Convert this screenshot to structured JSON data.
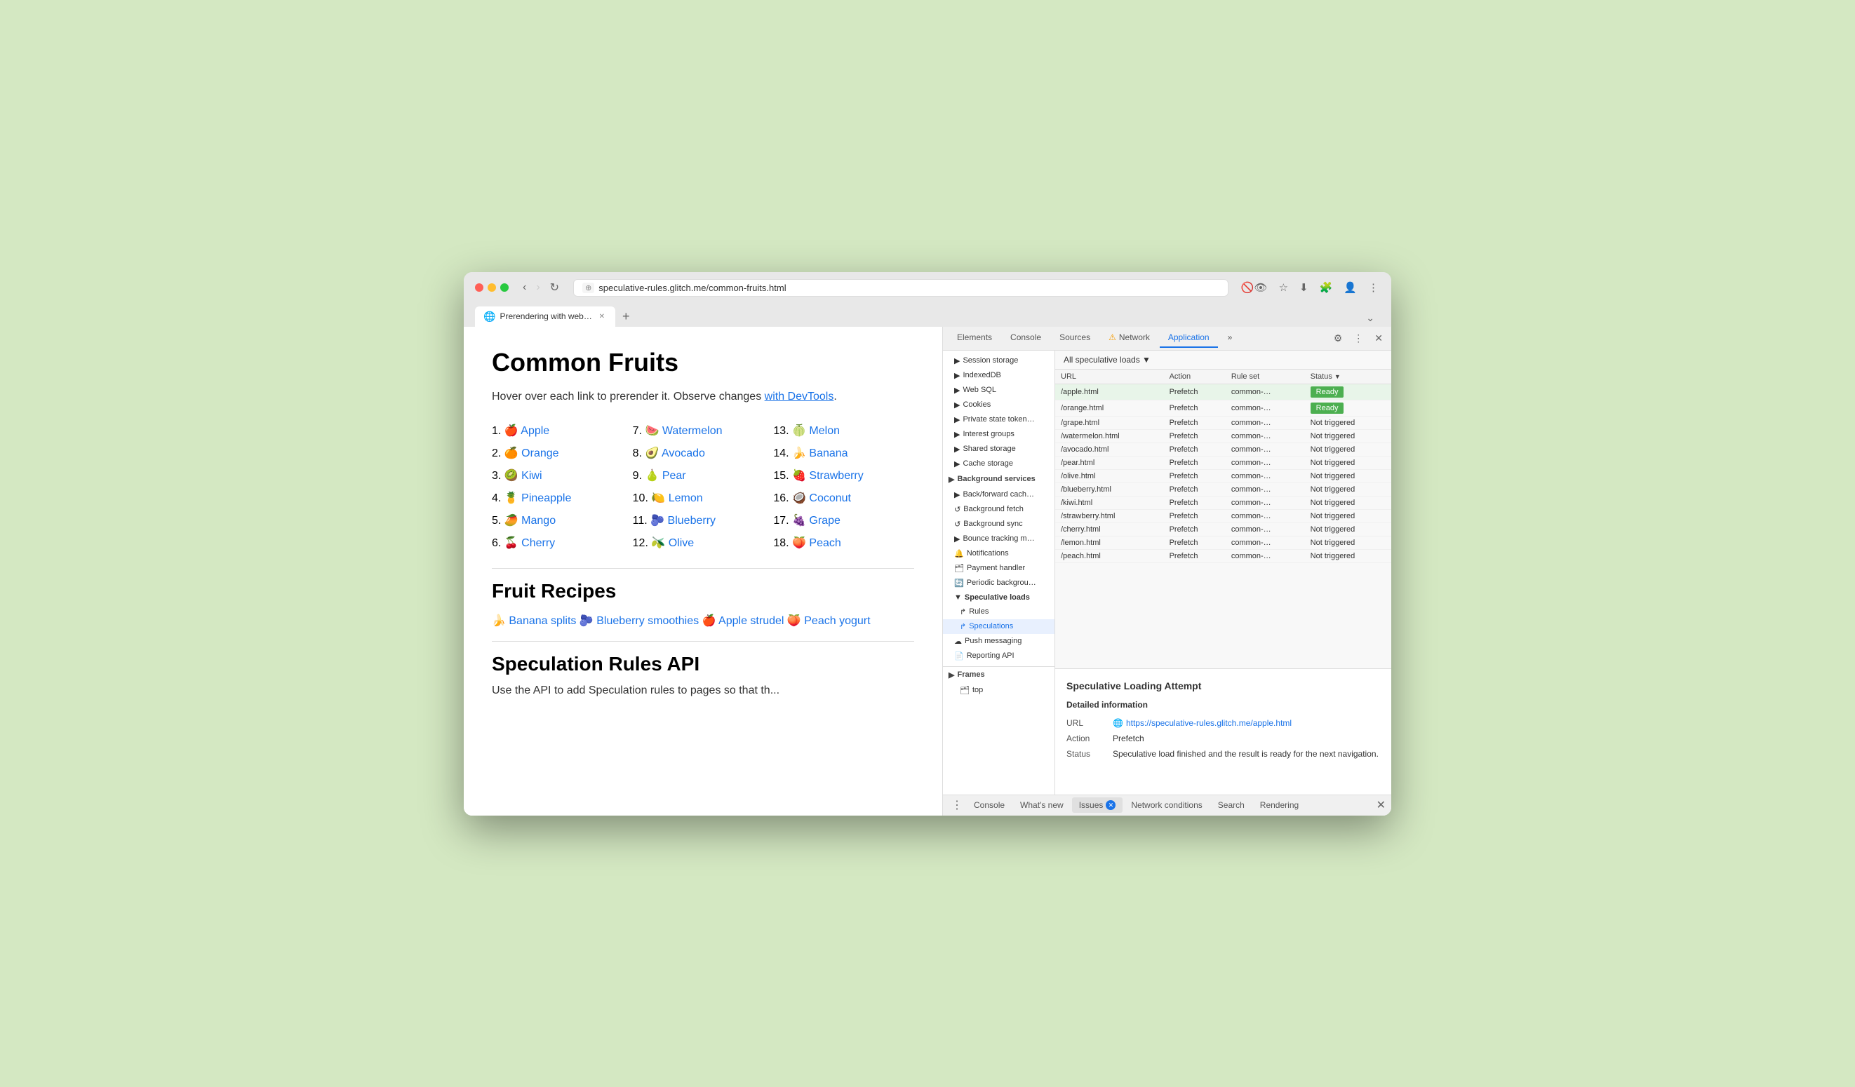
{
  "browser": {
    "url": "speculative-rules.glitch.me/common-fruits.html",
    "tab_title": "Prerendering with web-vitals...",
    "tab_favicon": "🌐",
    "new_tab_label": "+",
    "dropdown_label": "⌄"
  },
  "page": {
    "title": "Common Fruits",
    "description_text": "Hover over each link to prerender it. Observe changes ",
    "description_link": "with DevTools",
    "description_suffix": ".",
    "fruits": [
      {
        "num": "1.",
        "emoji": "🍎",
        "name": "Apple",
        "href": "#"
      },
      {
        "num": "2.",
        "emoji": "🍊",
        "name": "Orange",
        "href": "#"
      },
      {
        "num": "3.",
        "emoji": "🥝",
        "name": "Kiwi",
        "href": "#"
      },
      {
        "num": "4.",
        "emoji": "🍍",
        "name": "Pineapple",
        "href": "#"
      },
      {
        "num": "5.",
        "emoji": "🥭",
        "name": "Mango",
        "href": "#"
      },
      {
        "num": "6.",
        "emoji": "🍒",
        "name": "Cherry",
        "href": "#"
      },
      {
        "num": "7.",
        "emoji": "🍉",
        "name": "Watermelon",
        "href": "#"
      },
      {
        "num": "8.",
        "emoji": "🥑",
        "name": "Avocado",
        "href": "#"
      },
      {
        "num": "9.",
        "emoji": "🍐",
        "name": "Pear",
        "href": "#"
      },
      {
        "num": "10.",
        "emoji": "🍋",
        "name": "Lemon",
        "href": "#"
      },
      {
        "num": "11.",
        "emoji": "🫐",
        "name": "Blueberry",
        "href": "#"
      },
      {
        "num": "12.",
        "emoji": "🫒",
        "name": "Olive",
        "href": "#"
      },
      {
        "num": "13.",
        "emoji": "🍈",
        "name": "Melon",
        "href": "#"
      },
      {
        "num": "14.",
        "emoji": "🍌",
        "name": "Banana",
        "href": "#"
      },
      {
        "num": "15.",
        "emoji": "🍓",
        "name": "Strawberry",
        "href": "#"
      },
      {
        "num": "16.",
        "emoji": "🥥",
        "name": "Coconut",
        "href": "#"
      },
      {
        "num": "17.",
        "emoji": "🍇",
        "name": "Grape",
        "href": "#"
      },
      {
        "num": "18.",
        "emoji": "🍑",
        "name": "Peach",
        "href": "#"
      }
    ],
    "recipes_title": "Fruit Recipes",
    "recipes": [
      {
        "emoji": "🍌",
        "name": "Banana splits",
        "href": "#"
      },
      {
        "emoji": "🫐",
        "name": "Blueberry smoothies",
        "href": "#"
      },
      {
        "emoji": "🍎",
        "name": "Apple strudel",
        "href": "#"
      },
      {
        "emoji": "🍑",
        "name": "Peach yogurt",
        "href": "#"
      }
    ],
    "api_title": "Speculation Rules API",
    "api_description": "Use the API to add Speculation rules to pages so that th..."
  },
  "devtools": {
    "tabs": [
      {
        "label": "Elements",
        "active": false
      },
      {
        "label": "Console",
        "active": false
      },
      {
        "label": "Sources",
        "active": false
      },
      {
        "label": "Network",
        "active": false,
        "warning": true
      },
      {
        "label": "Application",
        "active": true
      },
      {
        "label": "»",
        "active": false
      }
    ],
    "settings_icon": "⚙",
    "more_icon": "⋮",
    "close_icon": "✕",
    "sidebar": {
      "storage_items": [
        {
          "label": "Session storage",
          "icon": "▶",
          "indent": false
        },
        {
          "label": "IndexedDB",
          "icon": "▶",
          "indent": false
        },
        {
          "label": "Web SQL",
          "icon": "▶",
          "indent": false
        },
        {
          "label": "Cookies",
          "icon": "▶",
          "indent": false
        },
        {
          "label": "Private state tokens",
          "icon": "▶",
          "indent": false
        },
        {
          "label": "Interest groups",
          "icon": "▶",
          "indent": false
        },
        {
          "label": "Shared storage",
          "icon": "▶",
          "indent": false
        },
        {
          "label": "Cache storage",
          "icon": "▶",
          "indent": false
        }
      ],
      "background_services": [
        {
          "label": "Back/forward cache",
          "icon": "▶",
          "indent": false
        },
        {
          "label": "Background fetch",
          "icon": "↺",
          "indent": false
        },
        {
          "label": "Background sync",
          "icon": "↺",
          "indent": false
        },
        {
          "label": "Bounce tracking m…",
          "icon": "▶",
          "indent": false
        },
        {
          "label": "Notifications",
          "icon": "🔔",
          "indent": false
        },
        {
          "label": "Payment handler",
          "icon": "🗂",
          "indent": false
        },
        {
          "label": "Periodic background…",
          "icon": "🔄",
          "indent": false
        },
        {
          "label": "Speculative loads",
          "icon": "▼",
          "indent": false,
          "selected": true
        },
        {
          "label": "Rules",
          "icon": "↱",
          "indent": true
        },
        {
          "label": "Speculations",
          "icon": "↱",
          "indent": true,
          "selected": true
        },
        {
          "label": "Push messaging",
          "icon": "☁",
          "indent": false
        },
        {
          "label": "Reporting API",
          "icon": "📄",
          "indent": false
        }
      ],
      "frames_label": "Frames",
      "frames_items": [
        {
          "label": "top",
          "icon": "🗂"
        }
      ]
    },
    "speculative_loads": {
      "filter_label": "All speculative loads ▼",
      "columns": [
        "URL",
        "Action",
        "Rule set",
        "Status"
      ],
      "rows": [
        {
          "url": "/apple.html",
          "action": "Prefetch",
          "rule_set": "common-…",
          "status": "Ready",
          "highlighted": true
        },
        {
          "url": "/orange.html",
          "action": "Prefetch",
          "rule_set": "common-…",
          "status": "Ready",
          "highlighted": false
        },
        {
          "url": "/grape.html",
          "action": "Prefetch",
          "rule_set": "common-…",
          "status": "Not triggered",
          "highlighted": false
        },
        {
          "url": "/watermelon.html",
          "action": "Prefetch",
          "rule_set": "common-…",
          "status": "Not triggered",
          "highlighted": false
        },
        {
          "url": "/avocado.html",
          "action": "Prefetch",
          "rule_set": "common-…",
          "status": "Not triggered",
          "highlighted": false
        },
        {
          "url": "/pear.html",
          "action": "Prefetch",
          "rule_set": "common-…",
          "status": "Not triggered",
          "highlighted": false
        },
        {
          "url": "/olive.html",
          "action": "Prefetch",
          "rule_set": "common-…",
          "status": "Not triggered",
          "highlighted": false
        },
        {
          "url": "/blueberry.html",
          "action": "Prefetch",
          "rule_set": "common-…",
          "status": "Not triggered",
          "highlighted": false
        },
        {
          "url": "/kiwi.html",
          "action": "Prefetch",
          "rule_set": "common-…",
          "status": "Not triggered",
          "highlighted": false
        },
        {
          "url": "/strawberry.html",
          "action": "Prefetch",
          "rule_set": "common-…",
          "status": "Not triggered",
          "highlighted": false
        },
        {
          "url": "/cherry.html",
          "action": "Prefetch",
          "rule_set": "common-…",
          "status": "Not triggered",
          "highlighted": false
        },
        {
          "url": "/lemon.html",
          "action": "Prefetch",
          "rule_set": "common-…",
          "status": "Not triggered",
          "highlighted": false
        },
        {
          "url": "/peach.html",
          "action": "Prefetch",
          "rule_set": "common-…",
          "status": "Not triggered",
          "highlighted": false
        }
      ]
    },
    "detail_panel": {
      "title": "Speculative Loading Attempt",
      "subtitle": "Detailed information",
      "url_label": "URL",
      "url_value": "https://speculative-rules.glitch.me/apple.html",
      "action_label": "Action",
      "action_value": "Prefetch",
      "status_label": "Status",
      "status_value": "Speculative load finished and the result is ready for the next navigation."
    },
    "bottom_tabs": [
      {
        "label": "Console",
        "active": false
      },
      {
        "label": "What's new",
        "active": false
      },
      {
        "label": "Issues",
        "active": true,
        "badge": "×"
      },
      {
        "label": "Network conditions",
        "active": false
      },
      {
        "label": "Search",
        "active": false
      },
      {
        "label": "Rendering",
        "active": false
      }
    ]
  }
}
